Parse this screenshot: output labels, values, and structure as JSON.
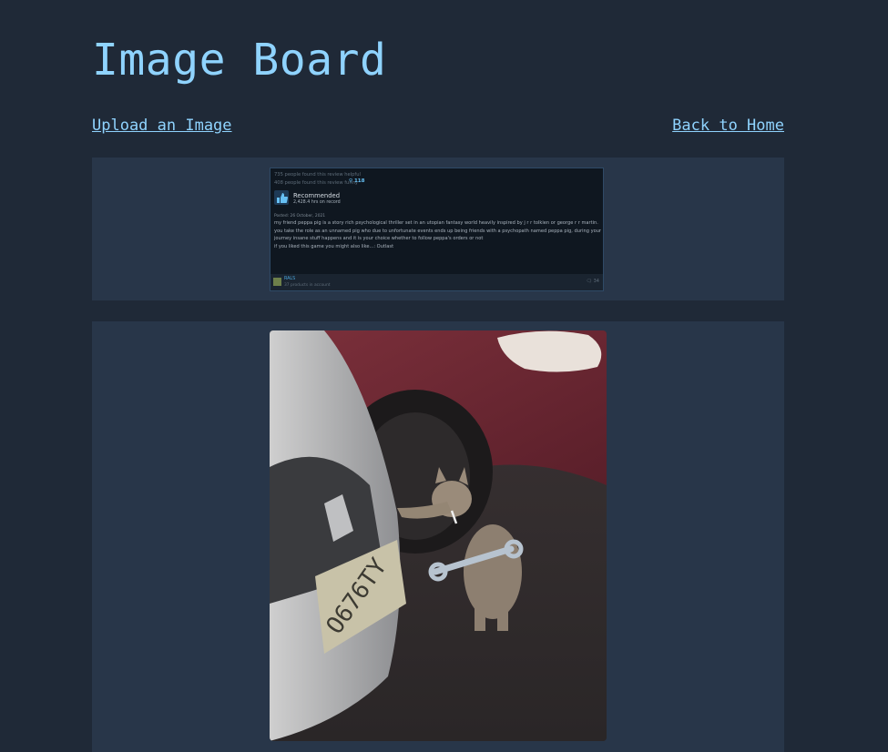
{
  "header": {
    "title": "Image Board"
  },
  "nav": {
    "upload_label": "Upload an Image",
    "home_label": "Back to Home"
  },
  "posts": [
    {
      "review": {
        "helpful": "735 people found this review helpful",
        "funny": "408 people found this review funny",
        "awards": "118",
        "verdict": "Recommended",
        "hours": "2,428.4 hrs on record",
        "posted": "Posted: 26 October, 2021",
        "lines": [
          "my friend peppa pig is a story rich psychological thriller set in an utopian fantasy world heavily inspired by j r r tolkien or george r r martin.",
          "you take the role as an unnamed pig who due to unfortunate events ends up being friends with a psychopath named peppa pig, during your",
          "journey insane stuff happens and it is your choice whether to follow peppa's orders or not",
          "if you liked this game you might also like...: Outlast"
        ],
        "username": "RALS",
        "products": "37 products in account",
        "comments": "34"
      }
    },
    {
      "photo": {
        "plate": "O676TY",
        "icon": "cat-with-wrench-photo"
      }
    }
  ],
  "colors": {
    "background": "#1f2937",
    "card": "#283649",
    "link": "#8fd3fe"
  }
}
